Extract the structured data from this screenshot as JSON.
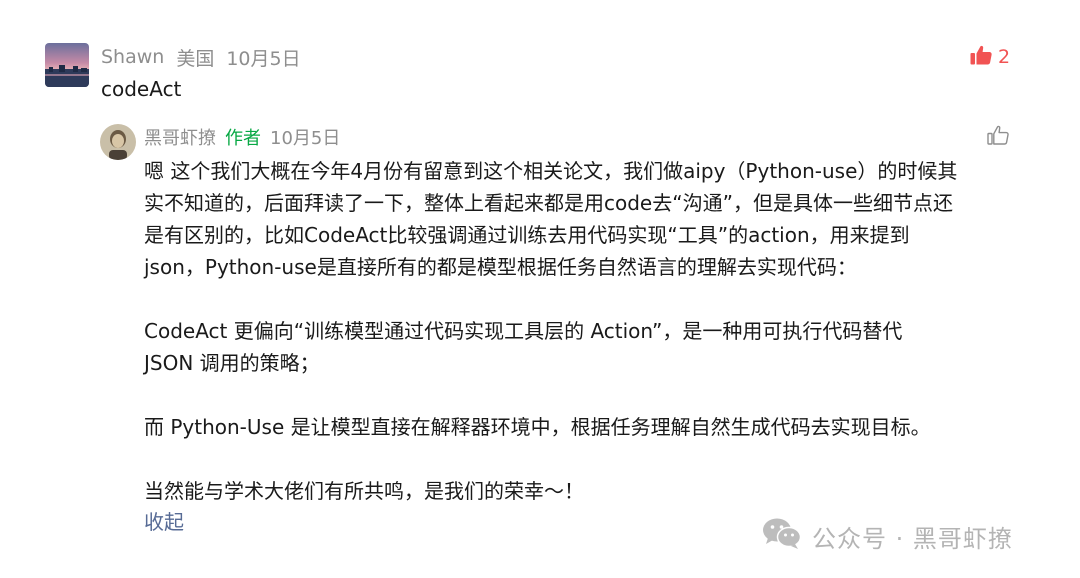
{
  "comment": {
    "username": "Shawn",
    "location": "美国",
    "date": "10月5日",
    "text": "codeAct",
    "like_count": "2",
    "like_icon": "thumbs-up-filled-icon",
    "accent_color": "#f15353"
  },
  "reply": {
    "username": "黑哥虾撩",
    "author_tag": "作者",
    "date": "10月5日",
    "like_icon": "thumbs-up-outline-icon",
    "author_color": "#07a844",
    "paragraphs": [
      [
        "嗯 这个我们大概在今年4月份有留意到这个相关论文，我们做aipy（Python-use）的时候其",
        "实不知道的，后面拜读了一下，整体上看起来都是用code去“沟通”，但是具体一些细节点还",
        "是有区别的，比如CodeAct比较强调通过训练去用代码实现“工具”的action，用来提到",
        "json，Python-use是直接所有的都是模型根据任务自然语言的理解去实现代码："
      ],
      [
        "CodeAct 更偏向“训练模型通过代码实现工具层的 Action”，是一种用可执行代码替代",
        "JSON 调用的策略；"
      ],
      [
        "而 Python-Use 是让模型直接在解释器环境中，根据任务理解自然生成代码去实现目标。"
      ],
      [
        "当然能与学术大佬们有所共鸣，是我们的荣幸～！"
      ]
    ],
    "collapse_label": "收起",
    "link_color": "#576b95"
  },
  "watermark": {
    "icon": "wechat-icon",
    "text": "公众号 · 黑哥虾撩"
  }
}
